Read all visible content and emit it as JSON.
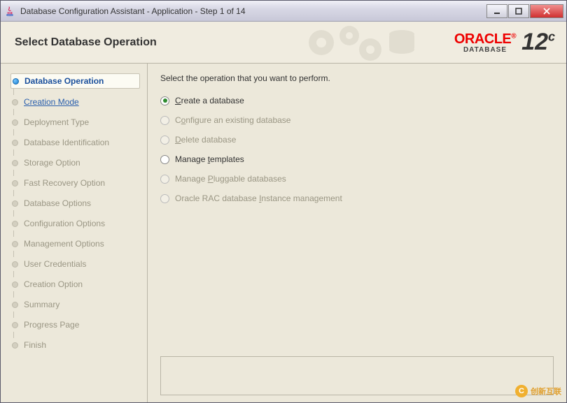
{
  "window": {
    "title": "Database Configuration Assistant - Application - Step 1 of 14"
  },
  "header": {
    "title": "Select Database Operation",
    "brand_primary": "ORACLE",
    "brand_reg": "®",
    "brand_secondary": "DATABASE",
    "version": "12",
    "version_suffix": "c"
  },
  "sidebar": {
    "steps": [
      {
        "label": "Database Operation",
        "state": "current"
      },
      {
        "label": "Creation Mode",
        "state": "next"
      },
      {
        "label": "Deployment Type",
        "state": "disabled"
      },
      {
        "label": "Database Identification",
        "state": "disabled"
      },
      {
        "label": "Storage Option",
        "state": "disabled"
      },
      {
        "label": "Fast Recovery Option",
        "state": "disabled"
      },
      {
        "label": "Database Options",
        "state": "disabled"
      },
      {
        "label": "Configuration Options",
        "state": "disabled"
      },
      {
        "label": "Management Options",
        "state": "disabled"
      },
      {
        "label": "User Credentials",
        "state": "disabled"
      },
      {
        "label": "Creation Option",
        "state": "disabled"
      },
      {
        "label": "Summary",
        "state": "disabled"
      },
      {
        "label": "Progress Page",
        "state": "disabled"
      },
      {
        "label": "Finish",
        "state": "disabled"
      }
    ]
  },
  "main": {
    "instruction": "Select the operation that you want to perform.",
    "options": [
      {
        "pre": "",
        "accel": "C",
        "post": "reate a database",
        "enabled": true,
        "checked": true
      },
      {
        "pre": "C",
        "accel": "o",
        "post": "nfigure an existing database",
        "enabled": false,
        "checked": false
      },
      {
        "pre": "",
        "accel": "D",
        "post": "elete database",
        "enabled": false,
        "checked": false
      },
      {
        "pre": "Manage ",
        "accel": "t",
        "post": "emplates",
        "enabled": true,
        "checked": false
      },
      {
        "pre": "Manage ",
        "accel": "P",
        "post": "luggable databases",
        "enabled": false,
        "checked": false
      },
      {
        "pre": "Oracle RAC database ",
        "accel": "I",
        "post": "nstance management",
        "enabled": false,
        "checked": false
      }
    ]
  },
  "watermark": {
    "text": "创新互联",
    "badge": "C"
  }
}
